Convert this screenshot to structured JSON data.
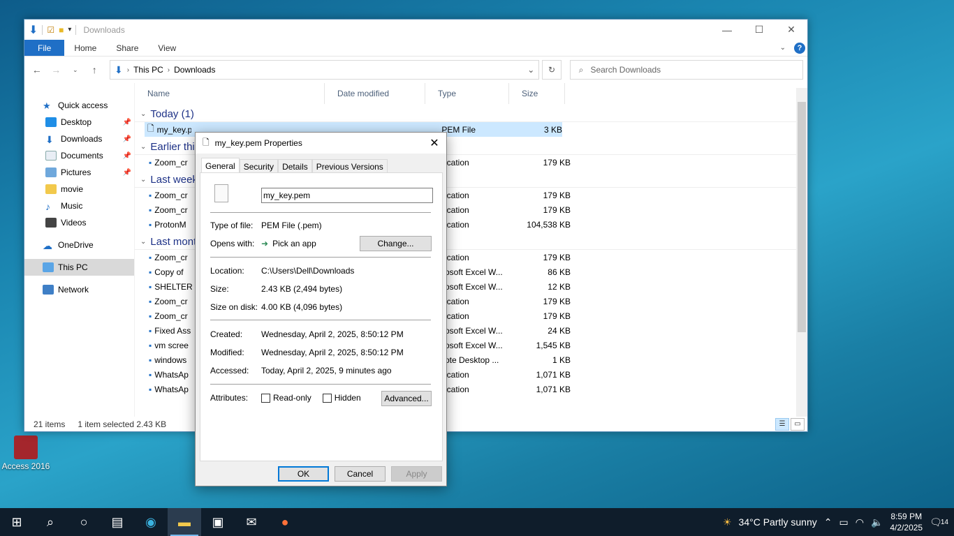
{
  "desktop": {
    "icons": [
      {
        "label": "Access 2016"
      }
    ]
  },
  "explorer": {
    "title": "Downloads",
    "ribbon_tabs": [
      "File",
      "Home",
      "Share",
      "View"
    ],
    "breadcrumb": [
      "This PC",
      "Downloads"
    ],
    "search_placeholder": "Search Downloads",
    "nav": {
      "quick_access": "Quick access",
      "desktop": "Desktop",
      "downloads": "Downloads",
      "documents": "Documents",
      "pictures": "Pictures",
      "movie": "movie",
      "music": "Music",
      "videos": "Videos",
      "onedrive": "OneDrive",
      "this_pc": "This PC",
      "network": "Network"
    },
    "columns": [
      "Name",
      "Date modified",
      "Type",
      "Size"
    ],
    "groups": {
      "today": "Today (1)",
      "earlier": "Earlier thi",
      "last_week": "Last week",
      "last_month": "Last mont"
    },
    "selected_row": {
      "name": "my_key.p",
      "type": "PEM File",
      "size": "3 KB"
    },
    "earlier_rows": [
      {
        "name": "Zoom_cr",
        "type": "ication",
        "size": "179 KB"
      }
    ],
    "last_week_rows": [
      {
        "name": "Zoom_cr",
        "type": "ication",
        "size": "179 KB"
      },
      {
        "name": "Zoom_cr",
        "type": "ication",
        "size": "179 KB"
      },
      {
        "name": "ProtonM",
        "type": "ication",
        "size": "104,538 KB"
      }
    ],
    "last_month_rows": [
      {
        "name": "Zoom_cr",
        "type": "ication",
        "size": "179 KB"
      },
      {
        "name": "Copy of",
        "type": "osoft Excel W...",
        "size": "86 KB"
      },
      {
        "name": "SHELTER",
        "type": "osoft Excel W...",
        "size": "12 KB"
      },
      {
        "name": "Zoom_cr",
        "type": "ication",
        "size": "179 KB"
      },
      {
        "name": "Zoom_cr",
        "type": "ication",
        "size": "179 KB"
      },
      {
        "name": "Fixed Ass",
        "type": "osoft Excel W...",
        "size": "24 KB"
      },
      {
        "name": "vm scree",
        "type": "osoft Excel W...",
        "size": "1,545 KB"
      },
      {
        "name": "windows",
        "type": "ote Desktop ...",
        "size": "1 KB"
      },
      {
        "name": "WhatsAp",
        "type": "ication",
        "size": "1,071 KB"
      },
      {
        "name": "WhatsAp",
        "type": "ication",
        "size": "1,071 KB"
      }
    ],
    "status": {
      "items": "21 items",
      "selected": "1 item selected  2.43 KB"
    }
  },
  "properties": {
    "title": "my_key.pem Properties",
    "tabs": [
      "General",
      "Security",
      "Details",
      "Previous Versions"
    ],
    "filename": "my_key.pem",
    "type_label": "Type of file:",
    "type_value": "PEM File (.pem)",
    "opens_label": "Opens with:",
    "opens_value": "Pick an app",
    "change_btn": "Change...",
    "location_label": "Location:",
    "location_value": "C:\\Users\\Dell\\Downloads",
    "size_label": "Size:",
    "size_value": "2.43 KB (2,494 bytes)",
    "disk_label": "Size on disk:",
    "disk_value": "4.00 KB (4,096 bytes)",
    "created_label": "Created:",
    "created_value": "Wednesday, April 2, 2025, 8:50:12 PM",
    "modified_label": "Modified:",
    "modified_value": "Wednesday, April 2, 2025, 8:50:12 PM",
    "accessed_label": "Accessed:",
    "accessed_value": "Today, April 2, 2025, 9 minutes ago",
    "attributes_label": "Attributes:",
    "readonly": "Read-only",
    "hidden": "Hidden",
    "advanced_btn": "Advanced...",
    "ok": "OK",
    "cancel": "Cancel",
    "apply": "Apply"
  },
  "taskbar": {
    "weather": "34°C  Partly sunny",
    "time": "8:59 PM",
    "date": "4/2/2025",
    "notifications": "14"
  }
}
